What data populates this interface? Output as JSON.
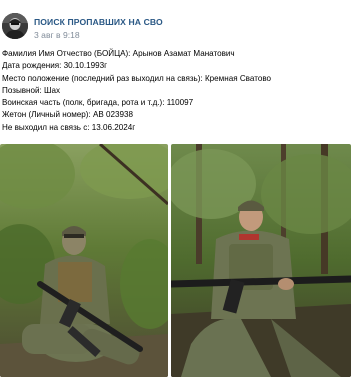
{
  "post": {
    "author": "ПОИСК ПРОПАВШИХ НА СВО",
    "date": "3 авг в 9:18",
    "lines": [
      "Фамилия Имя Отчество (БОЙЦА): Арынов Азамат Манатович",
      "Дата рождения: 30.10.1993г",
      "Место положение (последний раз выходил на связь): Кремная Сватово",
      "Позывной: Шах",
      "Воинская часть (полк, бригада, рота и т.д.): 110097",
      "Жетон (Личный номер): АВ 023938",
      "Не выходил на связь с: 13.06.2024г"
    ]
  },
  "colors": {
    "author_link": "#2a5885",
    "meta_gray": "#818c99",
    "foliage": "#4f6b2e",
    "camouflage": "#6d7452"
  },
  "icons": {
    "avatar": "soldier-avatar-icon"
  }
}
